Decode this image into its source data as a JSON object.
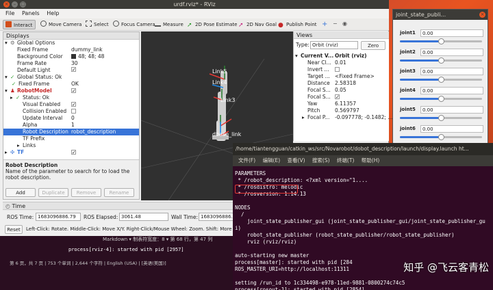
{
  "rviz": {
    "title": "urdf.rviz* - RViz",
    "menu": [
      "File",
      "Panels",
      "Help"
    ],
    "toolbar": [
      "Interact",
      "Move Camera",
      "Select",
      "Focus Camera",
      "Measure",
      "2D Pose Estimate",
      "2D Nav Goal",
      "Publish Point"
    ],
    "displays": {
      "title": "Displays",
      "rows": [
        {
          "label": "Global Options",
          "value": ""
        },
        {
          "label": "Fixed Frame",
          "value": "dummy_link"
        },
        {
          "label": "Background Color",
          "value": "48; 48; 48"
        },
        {
          "label": "Frame Rate",
          "value": "30"
        },
        {
          "label": "Default Light",
          "value": ""
        },
        {
          "label": "Global Status: Ok",
          "value": ""
        },
        {
          "label": "Fixed Frame",
          "value": "OK"
        },
        {
          "label": "RobotModel",
          "value": ""
        },
        {
          "label": "Status: Ok",
          "value": ""
        },
        {
          "label": "Visual Enabled",
          "value": ""
        },
        {
          "label": "Collision Enabled",
          "value": ""
        },
        {
          "label": "Update Interval",
          "value": "0"
        },
        {
          "label": "Alpha",
          "value": "1"
        },
        {
          "label": "Robot Description",
          "value": "robot_description"
        },
        {
          "label": "TF Prefix",
          "value": ""
        },
        {
          "label": "Links",
          "value": ""
        },
        {
          "label": "TF",
          "value": ""
        }
      ],
      "desc_title": "Robot Description",
      "desc_text": "Name of the parameter to search for to load the robot description.",
      "buttons": [
        "Add",
        "Duplicate",
        "Remove",
        "Rename"
      ]
    },
    "viewport_labels": [
      "Link5",
      "Link4",
      "Link3",
      "dbase_link"
    ],
    "views": {
      "title": "Views",
      "type_label": "Type:",
      "type_value": "Orbit (rviz)",
      "zero": "Zero",
      "rows": [
        {
          "label": "Current V...",
          "value": "Orbit (rviz)"
        },
        {
          "label": "Near Cl...",
          "value": "0.01"
        },
        {
          "label": "Invert ...",
          "value": ""
        },
        {
          "label": "Target ...",
          "value": "<Fixed Frame>"
        },
        {
          "label": "Distance",
          "value": "2.58318"
        },
        {
          "label": "Focal S...",
          "value": "0.05"
        },
        {
          "label": "Focal S...",
          "value": ""
        },
        {
          "label": "Yaw",
          "value": "6.11357"
        },
        {
          "label": "Pitch",
          "value": "0.569797"
        },
        {
          "label": "Focal P...",
          "value": "-0.097778; -0.1482; ..."
        }
      ]
    },
    "time": {
      "title": "Time",
      "ros_time_label": "ROS Time:",
      "ros_time": "1683096886.79",
      "ros_elapsed_label": "ROS Elapsed:",
      "ros_elapsed": "3061.48",
      "wall_time_label": "Wall Time:",
      "wall_time": "1683096886.8",
      "reset": "Reset",
      "hint": "Left-Click: Rotate. Middle-Click: Move X/Y. Right-Click/Mouse Wheel: Zoom. Shift: More options."
    }
  },
  "jsp": {
    "title": "joint_state_publi...",
    "joints": [
      {
        "name": "joint1",
        "value": "0.00",
        "fraction": 0.5
      },
      {
        "name": "joint2",
        "value": "0.00",
        "fraction": 0.5
      },
      {
        "name": "joint3",
        "value": "0.00",
        "fraction": 0.5
      },
      {
        "name": "joint4",
        "value": "0.00",
        "fraction": 0.5
      },
      {
        "name": "joint5",
        "value": "0.00",
        "fraction": 0.5
      },
      {
        "name": "joint6",
        "value": "0.00",
        "fraction": 0.5
      }
    ]
  },
  "terminal": {
    "title": "/home/tiantengguan/catkin_ws/src/Novarobot/dobot_description/launch/display.launch ht...",
    "menu": [
      "文件(F)",
      "编辑(E)",
      "查看(V)",
      "搜索(S)",
      "终端(T)",
      "帮助(H)"
    ],
    "lines": [
      "PARAMETERS",
      " * /robot_description: <?xml version=\"1....",
      " * /rosdistro: melodic",
      " * /rosversion: 1.14.13",
      "",
      "NODES",
      "  /",
      "    joint_state_publisher_gui (joint_state_publisher_gui/joint_state_publisher_gu",
      "i)",
      "    robot_state_publisher (robot_state_publisher/robot_state_publisher)",
      "    rviz (rviz/rviz)",
      "",
      "auto-starting new master",
      "process[master]: started with pid [284",
      "ROS_MASTER_URI=http://localhost:11311",
      "",
      "setting /run_id to 1c334498-e978-11ed-9881-0800274c74c5",
      "process[rosout-1]: started with pid [2854]"
    ]
  },
  "editor": {
    "lines": [
      "Markdown ▾   制表符宽度：8 ▾   第 68 行，第 47 列",
      "process[rviz-4]: started with pid [2957]",
      "第 6 页，共 7 页 | 753 个单词 | 2,644 个字符 | English (USA) | [英语(美国)]"
    ]
  },
  "watermark": "知乎 @飞云客青松"
}
